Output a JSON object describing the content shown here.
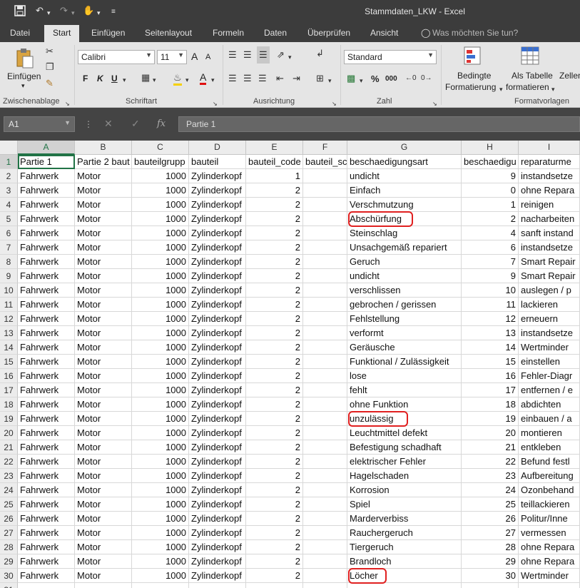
{
  "window": {
    "title": "Stammdaten_LKW - Excel",
    "save_icon": "save-icon",
    "undo_icon": "undo-icon",
    "redo_icon": "redo-icon",
    "touch_icon": "touch-mode-icon",
    "customize_icon": "customize-quick-access-icon"
  },
  "ribbon_tabs": [
    "Datei",
    "Start",
    "Einfügen",
    "Seitenlayout",
    "Formeln",
    "Daten",
    "Überprüfen",
    "Ansicht"
  ],
  "active_tab": "Start",
  "tell_me": "Was möchten Sie tun?",
  "ribbon": {
    "paste_label": "Einfügen",
    "clipboard_group": "Zwischenablage",
    "font_group": "Schriftart",
    "font_name": "Calibri",
    "font_size": "11",
    "bold": "F",
    "italic": "K",
    "underline": "U",
    "alignment_group": "Ausrichtung",
    "number_group": "Zahl",
    "number_format": "Standard",
    "cond_format_line1": "Bedingte",
    "cond_format_line2": "Formatierung",
    "as_table_line1": "Als Tabelle",
    "as_table_line2": "formatieren",
    "cell_styles": "Zellen",
    "styles_group": "Formatvorlagen",
    "accent_color": "#217346",
    "grow_font": "A",
    "shrink_font": "A",
    "font_color_label": "A",
    "percent": "%",
    "thousands": "000"
  },
  "formula_bar": {
    "name_box": "A1",
    "fx": "fx",
    "content": "Partie 1"
  },
  "columns": [
    "A",
    "B",
    "C",
    "D",
    "E",
    "F",
    "G",
    "H",
    "I"
  ],
  "header_row": [
    "Partie 1",
    "Partie 2 baut",
    "bauteilgrupp",
    "bauteil",
    "bauteil_code",
    "bauteil_sc",
    "beschaedigungsart",
    "beschaedigu",
    "reparaturme"
  ],
  "rows": [
    [
      "Fahrwerk",
      "Motor",
      "1000",
      "Zylinderkopf",
      "1",
      "",
      "undicht",
      "9",
      "instandsetze"
    ],
    [
      "Fahrwerk",
      "Motor",
      "1000",
      "Zylinderkopf",
      "2",
      "",
      "Einfach",
      "0",
      "ohne Repara"
    ],
    [
      "Fahrwerk",
      "Motor",
      "1000",
      "Zylinderkopf",
      "2",
      "",
      "Verschmutzung",
      "1",
      "reinigen"
    ],
    [
      "Fahrwerk",
      "Motor",
      "1000",
      "Zylinderkopf",
      "2",
      "",
      "Abschürfung",
      "2",
      "nacharbeiten"
    ],
    [
      "Fahrwerk",
      "Motor",
      "1000",
      "Zylinderkopf",
      "2",
      "",
      "Steinschlag",
      "4",
      "sanft instand"
    ],
    [
      "Fahrwerk",
      "Motor",
      "1000",
      "Zylinderkopf",
      "2",
      "",
      "Unsachgemäß repariert",
      "6",
      "instandsetze"
    ],
    [
      "Fahrwerk",
      "Motor",
      "1000",
      "Zylinderkopf",
      "2",
      "",
      "Geruch",
      "7",
      "Smart Repair"
    ],
    [
      "Fahrwerk",
      "Motor",
      "1000",
      "Zylinderkopf",
      "2",
      "",
      "undicht",
      "9",
      "Smart Repair"
    ],
    [
      "Fahrwerk",
      "Motor",
      "1000",
      "Zylinderkopf",
      "2",
      "",
      "verschlissen",
      "10",
      "auslegen / p"
    ],
    [
      "Fahrwerk",
      "Motor",
      "1000",
      "Zylinderkopf",
      "2",
      "",
      "gebrochen / gerissen",
      "11",
      "lackieren"
    ],
    [
      "Fahrwerk",
      "Motor",
      "1000",
      "Zylinderkopf",
      "2",
      "",
      "Fehlstellung",
      "12",
      "erneuern"
    ],
    [
      "Fahrwerk",
      "Motor",
      "1000",
      "Zylinderkopf",
      "2",
      "",
      "verformt",
      "13",
      "instandsetze"
    ],
    [
      "Fahrwerk",
      "Motor",
      "1000",
      "Zylinderkopf",
      "2",
      "",
      "Geräusche",
      "14",
      "Wertminder"
    ],
    [
      "Fahrwerk",
      "Motor",
      "1000",
      "Zylinderkopf",
      "2",
      "",
      "Funktional / Zulässigkeit",
      "15",
      "einstellen"
    ],
    [
      "Fahrwerk",
      "Motor",
      "1000",
      "Zylinderkopf",
      "2",
      "",
      "lose",
      "16",
      "Fehler-Diagr"
    ],
    [
      "Fahrwerk",
      "Motor",
      "1000",
      "Zylinderkopf",
      "2",
      "",
      "fehlt",
      "17",
      "entfernen / e"
    ],
    [
      "Fahrwerk",
      "Motor",
      "1000",
      "Zylinderkopf",
      "2",
      "",
      "ohne Funktion",
      "18",
      "abdichten"
    ],
    [
      "Fahrwerk",
      "Motor",
      "1000",
      "Zylinderkopf",
      "2",
      "",
      "unzulässig",
      "19",
      "einbauen / a"
    ],
    [
      "Fahrwerk",
      "Motor",
      "1000",
      "Zylinderkopf",
      "2",
      "",
      "Leuchtmittel defekt",
      "20",
      "montieren"
    ],
    [
      "Fahrwerk",
      "Motor",
      "1000",
      "Zylinderkopf",
      "2",
      "",
      "Befestigung schadhaft",
      "21",
      "entkleben"
    ],
    [
      "Fahrwerk",
      "Motor",
      "1000",
      "Zylinderkopf",
      "2",
      "",
      "elektrischer Fehler",
      "22",
      "Befund festl"
    ],
    [
      "Fahrwerk",
      "Motor",
      "1000",
      "Zylinderkopf",
      "2",
      "",
      "Hagelschaden",
      "23",
      "Aufbereitung"
    ],
    [
      "Fahrwerk",
      "Motor",
      "1000",
      "Zylinderkopf",
      "2",
      "",
      "Korrosion",
      "24",
      "Ozonbehand"
    ],
    [
      "Fahrwerk",
      "Motor",
      "1000",
      "Zylinderkopf",
      "2",
      "",
      "Spiel",
      "25",
      "teillackieren"
    ],
    [
      "Fahrwerk",
      "Motor",
      "1000",
      "Zylinderkopf",
      "2",
      "",
      "Marderverbiss",
      "26",
      "Politur/Inne"
    ],
    [
      "Fahrwerk",
      "Motor",
      "1000",
      "Zylinderkopf",
      "2",
      "",
      "Rauchergeruch",
      "27",
      "vermessen"
    ],
    [
      "Fahrwerk",
      "Motor",
      "1000",
      "Zylinderkopf",
      "2",
      "",
      "Tiergeruch",
      "28",
      "ohne Repara"
    ],
    [
      "Fahrwerk",
      "Motor",
      "1000",
      "Zylinderkopf",
      "2",
      "",
      "Brandloch",
      "29",
      "ohne Repara"
    ],
    [
      "Fahrwerk",
      "Motor",
      "1000",
      "Zylinderkopf",
      "2",
      "",
      "Löcher",
      "30",
      "Wertminder"
    ]
  ],
  "highlight_color": "#e02020",
  "highlighted_cells": [
    {
      "row": 5,
      "col": "G"
    },
    {
      "row": 19,
      "col": "G"
    },
    {
      "row": 30,
      "col": "G"
    }
  ]
}
